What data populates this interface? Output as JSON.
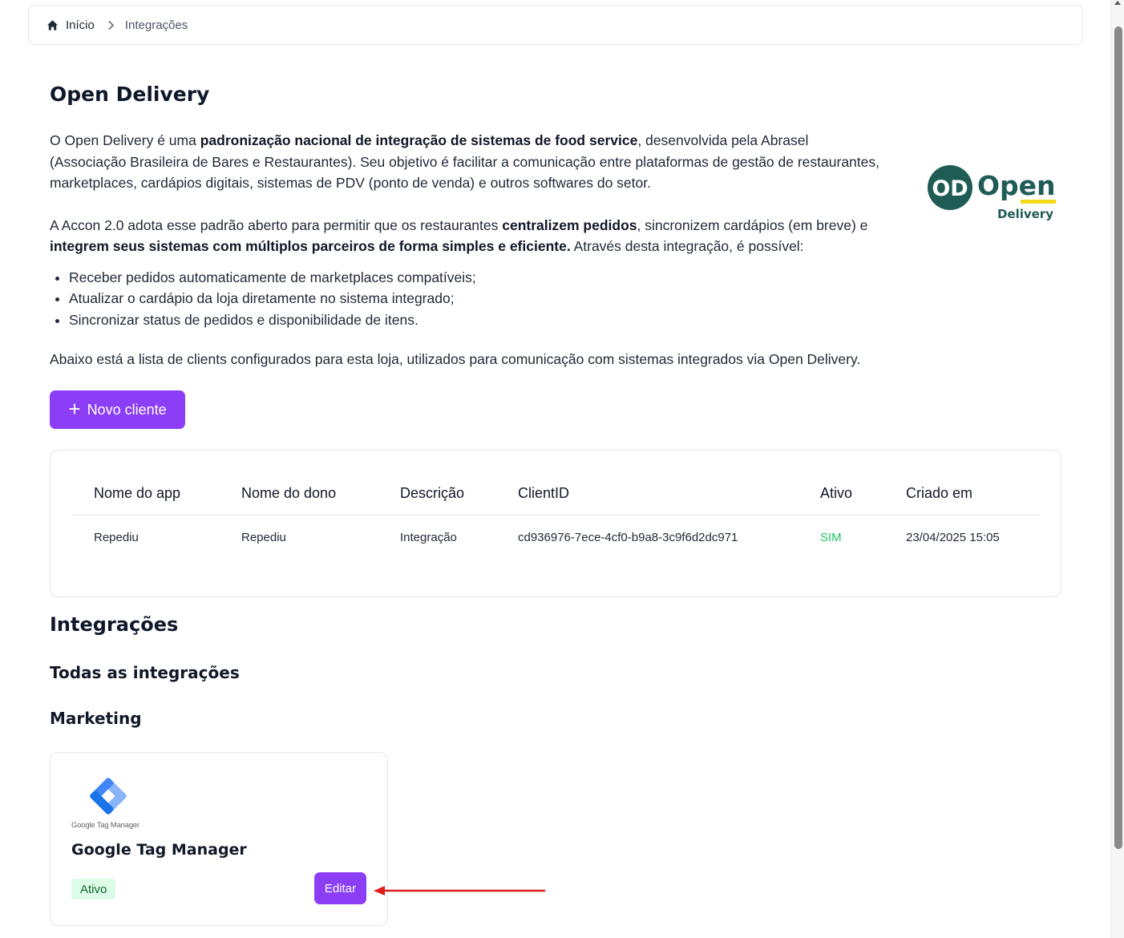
{
  "breadcrumb": {
    "home": "Início",
    "current": "Integrações"
  },
  "page": {
    "title": "Open Delivery",
    "intro_p1_a": "O Open Delivery é uma ",
    "intro_p1_b": "padronização nacional de integração de sistemas de food service",
    "intro_p1_c": ", desenvolvida pela Abrasel (Associação Brasileira de Bares e Restaurantes). Seu objetivo é facilitar a comunicação entre plataformas de gestão de restaurantes, marketplaces, cardápios digitais, sistemas de PDV (ponto de venda) e outros softwares do setor.",
    "intro_p2_a": "A Accon 2.0 adota esse padrão aberto para permitir que os restaurantes ",
    "intro_p2_b": "centralizem pedidos",
    "intro_p2_c": ", sincronizem cardápios (em breve) e ",
    "intro_p2_d": "integrem seus sistemas com múltiplos parceiros de forma simples e eficiente.",
    "intro_p2_e": " Através desta integração, é possível:",
    "bullets": [
      "Receber pedidos automaticamente de marketplaces compatíveis;",
      "Atualizar o cardápio da loja diretamente no sistema integrado;",
      "Sincronizar status de pedidos e disponibilidade de itens."
    ],
    "footnote": "Abaixo está a lista de clients configurados para esta loja, utilizados para comunicação com sistemas integrados via Open Delivery."
  },
  "logo": {
    "mark": "OD",
    "word1": "Open",
    "word2": "Delivery",
    "brand_color": "#1f5c55",
    "accent_color": "#f2d91a"
  },
  "new_client_label": "Novo cliente",
  "table": {
    "headers": [
      "Nome do app",
      "Nome do dono",
      "Descrição",
      "ClientID",
      "Ativo",
      "Criado em"
    ],
    "rows": [
      [
        "Repediu",
        "Repediu",
        "Integração",
        "cd936976-7ece-4cf0-b9a8-3c9f6d2dc971",
        "SIM",
        "23/04/2025 15:05"
      ]
    ]
  },
  "sections": {
    "integrations": "Integrações",
    "all": "Todas as integrações",
    "marketing": "Marketing"
  },
  "integration_card": {
    "logo_caption": "Google Tag Manager",
    "title": "Google Tag Manager",
    "status": "Ativo",
    "edit_label": "Editar"
  },
  "colors": {
    "primary": "#8b3ef5",
    "active_green": "#22c55e",
    "badge_bg": "#dcfce7",
    "annotation_red": "#e11d1d"
  }
}
